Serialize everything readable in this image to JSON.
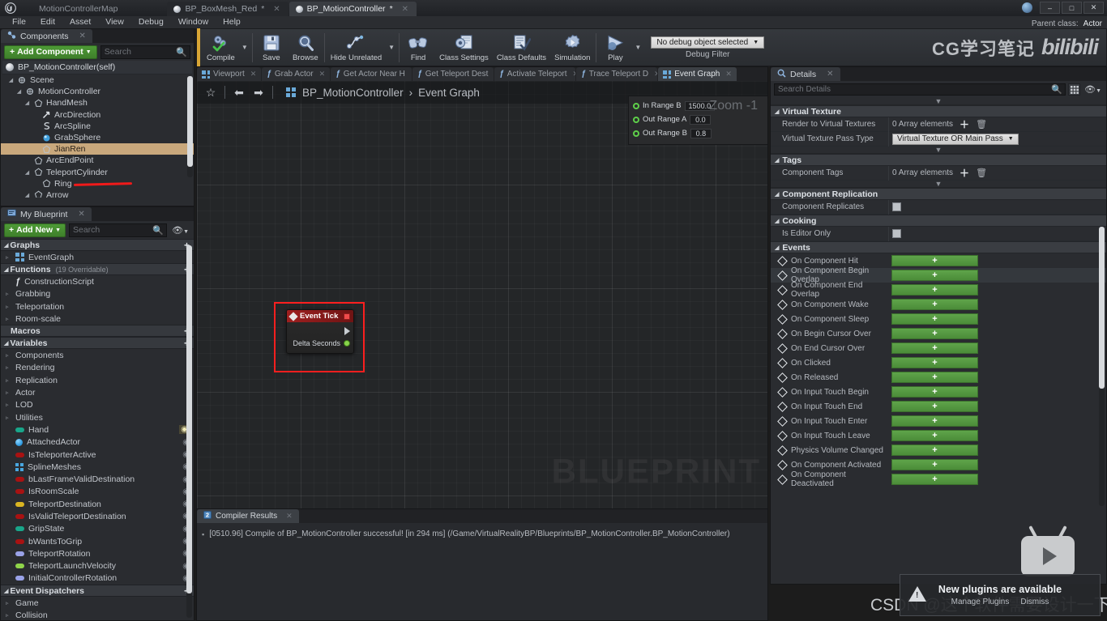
{
  "window": {
    "app_tabs": [
      {
        "label": "MotionControllerMap",
        "active": false,
        "has_dot": false,
        "closable": false
      },
      {
        "label": "BP_BoxMesh_Red",
        "active": false,
        "has_dot": true,
        "closable": true,
        "dirty": "*"
      },
      {
        "label": "BP_MotionController",
        "active": true,
        "has_dot": true,
        "closable": true,
        "dirty": "*"
      }
    ],
    "controls": {
      "minimize": "–",
      "maximize": "□",
      "close": "✕"
    },
    "parent_class_label": "Parent class:",
    "parent_class_value": "Actor"
  },
  "menubar": {
    "items": [
      "File",
      "Edit",
      "Asset",
      "View",
      "Debug",
      "Window",
      "Help"
    ]
  },
  "toolbar": {
    "buttons": [
      {
        "label": "Compile",
        "icon": "compile-icon",
        "glyph": "⚙",
        "caret": true
      },
      {
        "label": "Save",
        "icon": "save-icon",
        "glyph": "💾",
        "caret": false
      },
      {
        "label": "Browse",
        "icon": "browse-icon",
        "glyph": "🔍",
        "caret": false
      },
      {
        "label": "Hide Unrelated",
        "icon": "hide-unrelated-icon",
        "glyph": "⚬",
        "caret": true
      },
      {
        "label": "Find",
        "icon": "find-icon",
        "glyph": "🔭",
        "caret": false
      },
      {
        "label": "Class Settings",
        "icon": "class-settings-icon",
        "glyph": "⚙",
        "caret": false
      },
      {
        "label": "Class Defaults",
        "icon": "class-defaults-icon",
        "glyph": "🗒",
        "caret": false
      },
      {
        "label": "Simulation",
        "icon": "simulation-icon",
        "glyph": "▶",
        "caret": false
      },
      {
        "label": "Play",
        "icon": "play-icon",
        "glyph": "▶",
        "caret": true
      }
    ],
    "debug_filter": {
      "value": "No debug object selected",
      "caption": "Debug Filter"
    },
    "watermark_cn": "CG学习笔记",
    "watermark_brand": "bilibili"
  },
  "components_panel": {
    "tab_label": "Components",
    "tab_icon": "components-icon",
    "add_button": "Add Component",
    "search_placeholder": "Search",
    "root": "BP_MotionController(self)",
    "tree": [
      {
        "label": "Scene",
        "depth": 1,
        "arrow": true,
        "icon": "scene-icon",
        "selected": false
      },
      {
        "label": "MotionController",
        "depth": 2,
        "arrow": true,
        "icon": "motion-controller-icon",
        "selected": false
      },
      {
        "label": "HandMesh",
        "depth": 3,
        "arrow": true,
        "icon": "mesh-icon",
        "selected": false
      },
      {
        "label": "ArcDirection",
        "depth": 4,
        "arrow": false,
        "icon": "arrow-icon",
        "selected": false
      },
      {
        "label": "ArcSpline",
        "depth": 4,
        "arrow": false,
        "icon": "spline-icon",
        "selected": false
      },
      {
        "label": "GrabSphere",
        "depth": 4,
        "arrow": false,
        "icon": "sphere-icon",
        "selected": false
      },
      {
        "label": "JianRen",
        "depth": 4,
        "arrow": false,
        "icon": "mesh-icon",
        "selected": true
      },
      {
        "label": "ArcEndPoint",
        "depth": 3,
        "arrow": false,
        "icon": "mesh-icon",
        "selected": false
      },
      {
        "label": "TeleportCylinder",
        "depth": 3,
        "arrow": true,
        "icon": "mesh-icon",
        "selected": false
      },
      {
        "label": "Ring",
        "depth": 4,
        "arrow": false,
        "icon": "mesh-icon",
        "selected": false
      },
      {
        "label": "Arrow",
        "depth": 3,
        "arrow": true,
        "icon": "mesh-icon",
        "selected": false
      }
    ]
  },
  "my_blueprint_panel": {
    "tab_label": "My Blueprint",
    "tab_icon": "blueprint-icon",
    "add_button": "Add New",
    "search_placeholder": "Search",
    "sections": [
      {
        "title": "Graphs",
        "sub": "",
        "plus": true,
        "collapsible": true,
        "items": [
          {
            "label": "EventGraph",
            "arrow": true,
            "kind": "graph"
          }
        ]
      },
      {
        "title": "Functions",
        "sub": "(19 Overridable)",
        "plus": true,
        "collapsible": true,
        "items": [
          {
            "label": "ConstructionScript",
            "arrow": false,
            "kind": "function"
          },
          {
            "label": "Grabbing",
            "arrow": true,
            "kind": "folder"
          },
          {
            "label": "Teleportation",
            "arrow": true,
            "kind": "folder"
          },
          {
            "label": "Room-scale",
            "arrow": true,
            "kind": "folder"
          }
        ]
      },
      {
        "title": "Macros",
        "sub": "",
        "plus": true,
        "collapsible": false,
        "items": []
      },
      {
        "title": "Variables",
        "sub": "",
        "plus": true,
        "collapsible": true,
        "items": [
          {
            "label": "Components",
            "arrow": true,
            "kind": "folder"
          },
          {
            "label": "Rendering",
            "arrow": true,
            "kind": "folder"
          },
          {
            "label": "Replication",
            "arrow": true,
            "kind": "folder"
          },
          {
            "label": "Actor",
            "arrow": true,
            "kind": "folder"
          },
          {
            "label": "LOD",
            "arrow": true,
            "kind": "folder"
          },
          {
            "label": "Utilities",
            "arrow": true,
            "kind": "folder"
          },
          {
            "label": "Hand",
            "arrow": false,
            "kind": "var",
            "color": "#19a68a",
            "eye": "on"
          },
          {
            "label": "AttachedActor",
            "arrow": false,
            "kind": "sphere",
            "color": "#2e9ae0",
            "eye": "off"
          },
          {
            "label": "IsTeleporterActive",
            "arrow": false,
            "kind": "var",
            "color": "#a81212",
            "eye": "off"
          },
          {
            "label": "SplineMeshes",
            "arrow": false,
            "kind": "grid",
            "color": "#49a7e0",
            "eye": "off"
          },
          {
            "label": "bLastFrameValidDestination",
            "arrow": false,
            "kind": "var",
            "color": "#a81212",
            "eye": "off"
          },
          {
            "label": "IsRoomScale",
            "arrow": false,
            "kind": "var",
            "color": "#a81212",
            "eye": "off"
          },
          {
            "label": "TeleportDestination",
            "arrow": false,
            "kind": "var",
            "color": "#d9b522",
            "eye": "off"
          },
          {
            "label": "IsValidTeleportDestination",
            "arrow": false,
            "kind": "var",
            "color": "#a81212",
            "eye": "off"
          },
          {
            "label": "GripState",
            "arrow": false,
            "kind": "var",
            "color": "#19a68a",
            "eye": "off"
          },
          {
            "label": "bWantsToGrip",
            "arrow": false,
            "kind": "var",
            "color": "#a81212",
            "eye": "off"
          },
          {
            "label": "TeleportRotation",
            "arrow": false,
            "kind": "var",
            "color": "#9aa2e8",
            "eye": "off"
          },
          {
            "label": "TeleportLaunchVelocity",
            "arrow": false,
            "kind": "var",
            "color": "#8fd44a",
            "eye": "off"
          },
          {
            "label": "InitialControllerRotation",
            "arrow": false,
            "kind": "var",
            "color": "#9aa2e8",
            "eye": "off"
          }
        ]
      },
      {
        "title": "Event Dispatchers",
        "sub": "",
        "plus": true,
        "collapsible": true,
        "items": [
          {
            "label": "Game",
            "arrow": true,
            "kind": "folder"
          },
          {
            "label": "Collision",
            "arrow": true,
            "kind": "folder"
          }
        ]
      }
    ]
  },
  "graph_panel": {
    "tabs": [
      {
        "label": "Viewport",
        "icon": "viewport-icon",
        "active": false
      },
      {
        "label": "Grab Actor",
        "icon": "function-icon",
        "active": false
      },
      {
        "label": "Get Actor Near H",
        "icon": "function-icon",
        "active": false
      },
      {
        "label": "Get Teleport Dest",
        "icon": "function-icon",
        "active": false
      },
      {
        "label": "Activate Teleport",
        "icon": "function-icon",
        "active": false
      },
      {
        "label": "Trace Teleport D",
        "icon": "function-icon",
        "active": false
      },
      {
        "label": "Event Graph",
        "icon": "graph-icon",
        "active": true
      }
    ],
    "breadcrumb": {
      "root": "BP_MotionController",
      "sep": "›",
      "leaf": "Event Graph"
    },
    "zoom_label": "Zoom -1",
    "watermark": "BLUEPRINT",
    "clipped_node_pins": [
      {
        "label": "In Range B",
        "value": "1500.0"
      },
      {
        "label": "Out Range A",
        "value": "0.0"
      },
      {
        "label": "Out Range B",
        "value": "0.8"
      }
    ],
    "event_node": {
      "title": "Event Tick",
      "output_pin": "Delta Seconds"
    }
  },
  "details_panel": {
    "tab_label": "Details",
    "tab_icon": "details-icon",
    "search_placeholder": "Search Details",
    "sections": [
      {
        "title": "Virtual Texture",
        "rows": [
          {
            "label": "Render to Virtual Textures",
            "value": "0 Array elements",
            "type": "array"
          },
          {
            "label": "Virtual Texture Pass Type",
            "value": "Virtual Texture OR Main Pass",
            "type": "combo"
          }
        ]
      },
      {
        "title": "Tags",
        "rows": [
          {
            "label": "Component Tags",
            "value": "0 Array elements",
            "type": "array"
          }
        ]
      },
      {
        "title": "Component Replication",
        "rows": [
          {
            "label": "Component Replicates",
            "value": "",
            "type": "checkbox"
          }
        ]
      },
      {
        "title": "Cooking",
        "rows": [
          {
            "label": "Is Editor Only",
            "value": "",
            "type": "checkbox"
          }
        ]
      }
    ],
    "events_section_title": "Events",
    "events": [
      {
        "label": "On Component Hit",
        "button": "+",
        "highlight": false
      },
      {
        "label": "On Component Begin Overlap",
        "button": "+",
        "highlight": true
      },
      {
        "label": "On Component End Overlap",
        "button": "+",
        "highlight": false
      },
      {
        "label": "On Component Wake",
        "button": "+",
        "highlight": false
      },
      {
        "label": "On Component Sleep",
        "button": "+",
        "highlight": false
      },
      {
        "label": "On Begin Cursor Over",
        "button": "+",
        "highlight": false
      },
      {
        "label": "On End Cursor Over",
        "button": "+",
        "highlight": false
      },
      {
        "label": "On Clicked",
        "button": "+",
        "highlight": false
      },
      {
        "label": "On Released",
        "button": "+",
        "highlight": false
      },
      {
        "label": "On Input Touch Begin",
        "button": "+",
        "highlight": false
      },
      {
        "label": "On Input Touch End",
        "button": "+",
        "highlight": false
      },
      {
        "label": "On Input Touch Enter",
        "button": "+",
        "highlight": false
      },
      {
        "label": "On Input Touch Leave",
        "button": "+",
        "highlight": false
      },
      {
        "label": "Physics Volume Changed",
        "button": "+",
        "highlight": false
      },
      {
        "label": "On Component Activated",
        "button": "+",
        "highlight": false
      },
      {
        "label": "On Component Deactivated",
        "button": "+",
        "highlight": false
      }
    ],
    "accent_green": "#4b8c39"
  },
  "compiler_panel": {
    "tab_label": "Compiler Results",
    "tab_icon": "compiler-icon",
    "message": "[0510.96] Compile of BP_MotionController successful! [in 294 ms] (/Game/VirtualRealityBP/Blueprints/BP_MotionController.BP_MotionController)"
  },
  "notification": {
    "title": "New plugins are available",
    "actions": [
      "Manage Plugins",
      "Dismiss"
    ]
  },
  "overlays": {
    "csdn_watermark": "CSDN @这个软件需要设计一下"
  }
}
